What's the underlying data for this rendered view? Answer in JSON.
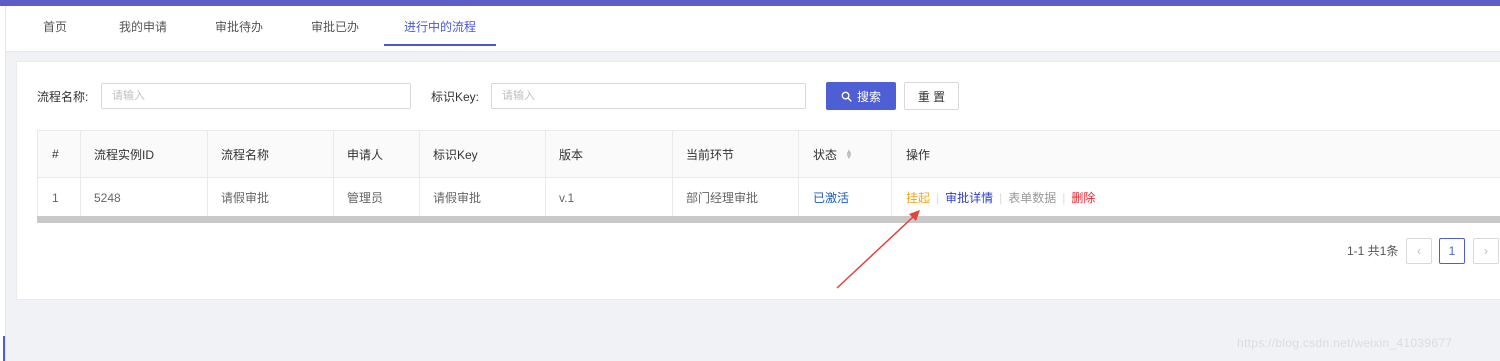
{
  "tabs": [
    {
      "label": "首页"
    },
    {
      "label": "我的申请"
    },
    {
      "label": "审批待办"
    },
    {
      "label": "审批已办"
    },
    {
      "label": "进行中的流程"
    }
  ],
  "active_tab_index": 4,
  "search": {
    "process_name_label": "流程名称:",
    "process_name_placeholder": "请输入",
    "key_label": "标识Key:",
    "key_placeholder": "请输入",
    "search_button": "搜索",
    "reset_button": "重 置"
  },
  "table": {
    "columns": [
      "#",
      "流程实例ID",
      "流程名称",
      "申请人",
      "标识Key",
      "版本",
      "当前环节",
      "状态",
      "操作"
    ],
    "rows": [
      {
        "index": "1",
        "instance_id": "5248",
        "process_name": "请假审批",
        "applicant": "管理员",
        "key": "请假审批",
        "version": "v.1",
        "current_node": "部门经理审批",
        "status": "已激活",
        "actions": {
          "suspend": "挂起",
          "detail": "审批详情",
          "form_data": "表单数据",
          "delete": "删除"
        }
      }
    ]
  },
  "pagination": {
    "total_text": "1-1 共1条",
    "current_page": "1"
  },
  "watermark": "https://blog.csdn.net/weixin_41039677",
  "colors": {
    "primary": "#4e5fd6",
    "suspend": "#f5a623",
    "delete": "#f5222d",
    "status_active": "#1a5fb4",
    "annotation_arrow": "#e0443a"
  },
  "icons": {
    "search_button_icon": "search-icon",
    "prev_page": "chevron-left-icon",
    "next_page": "chevron-right-icon",
    "sort": "sort-icon"
  }
}
